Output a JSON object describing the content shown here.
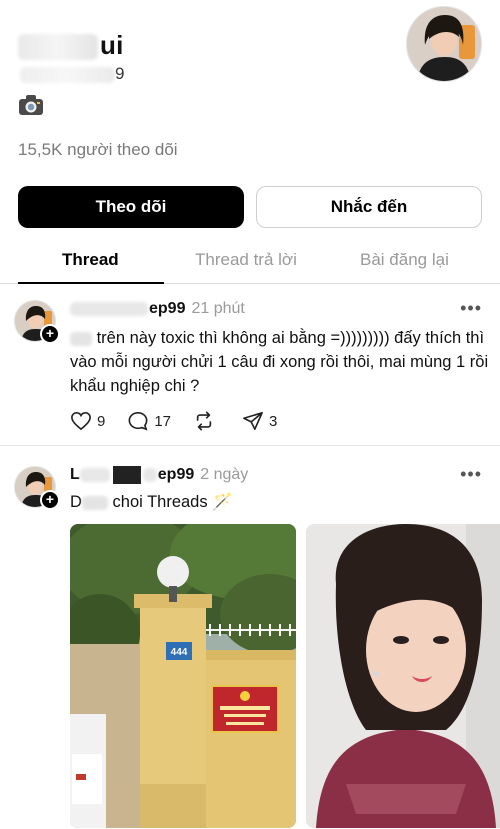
{
  "profile": {
    "name_suffix": "ui",
    "handle_suffix": "9",
    "followers": "15,5K người theo dõi"
  },
  "buttons": {
    "follow": "Theo dõi",
    "mention": "Nhắc đến"
  },
  "tabs": [
    {
      "label": "Thread"
    },
    {
      "label": "Thread trả lời"
    },
    {
      "label": "Bài đăng lại"
    }
  ],
  "posts": [
    {
      "user_suffix": "ep99",
      "time": "21 phút",
      "text": "trên này toxic thì không ai bằng =))))))))) đấy thích thì vào mỗi người chửi 1 câu đi xong rồi thôi, mai mùng 1 rồi khẩu nghiệp chi ?",
      "likes": "9",
      "comments": "17",
      "shares": "3",
      "more": "•••"
    },
    {
      "user_prefix": "L",
      "user_suffix": "ep99",
      "time": "2 ngày",
      "text_prefix": "D",
      "text": "choi Threads 🪄",
      "more": "•••",
      "photo1_sign": "CÔNG AN PHƯỜNG CỐNG VỊ",
      "photo1_number": "444"
    }
  ],
  "icons": {
    "plus": "+",
    "camera": "camera-icon"
  }
}
